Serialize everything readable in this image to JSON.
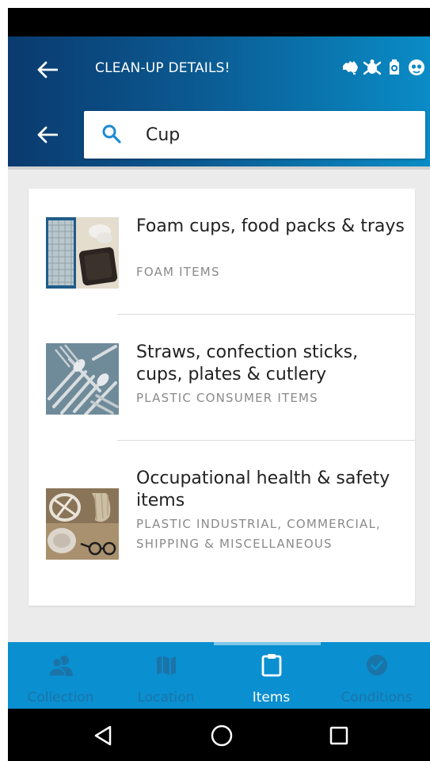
{
  "header": {
    "title": "CLEAN-UP DETAILS!",
    "icons": [
      "australia-map-icon",
      "turtle-icon",
      "lantern-icon",
      "face-icon"
    ]
  },
  "search": {
    "value": "Cup"
  },
  "results": [
    {
      "title": "Foam cups, food packs & trays",
      "category": "FOAM ITEMS",
      "image": "foam-cups-photo"
    },
    {
      "title": "Straws, confection sticks, cups, plates & cutlery",
      "category": "PLASTIC CONSUMER ITEMS",
      "image": "plastic-cutlery-photo"
    },
    {
      "title": "Occupational health & safety items",
      "category": "PLASTIC INDUSTRIAL, COMMERCIAL, SHIPPING & MISCELLANEOUS",
      "image": "safety-items-photo"
    }
  ],
  "nav": {
    "tabs": [
      {
        "label": "Collection",
        "icon": "people-icon"
      },
      {
        "label": "Location",
        "icon": "map-icon"
      },
      {
        "label": "Items",
        "icon": "clipboard-icon"
      },
      {
        "label": "Conditions",
        "icon": "check-circle-icon"
      }
    ],
    "active": "Items"
  },
  "colors": {
    "header_start": "#0a3a6e",
    "header_end": "#0a8cc6",
    "nav_bg": "#0a8fd0",
    "search_icon": "#1a8ad4"
  }
}
